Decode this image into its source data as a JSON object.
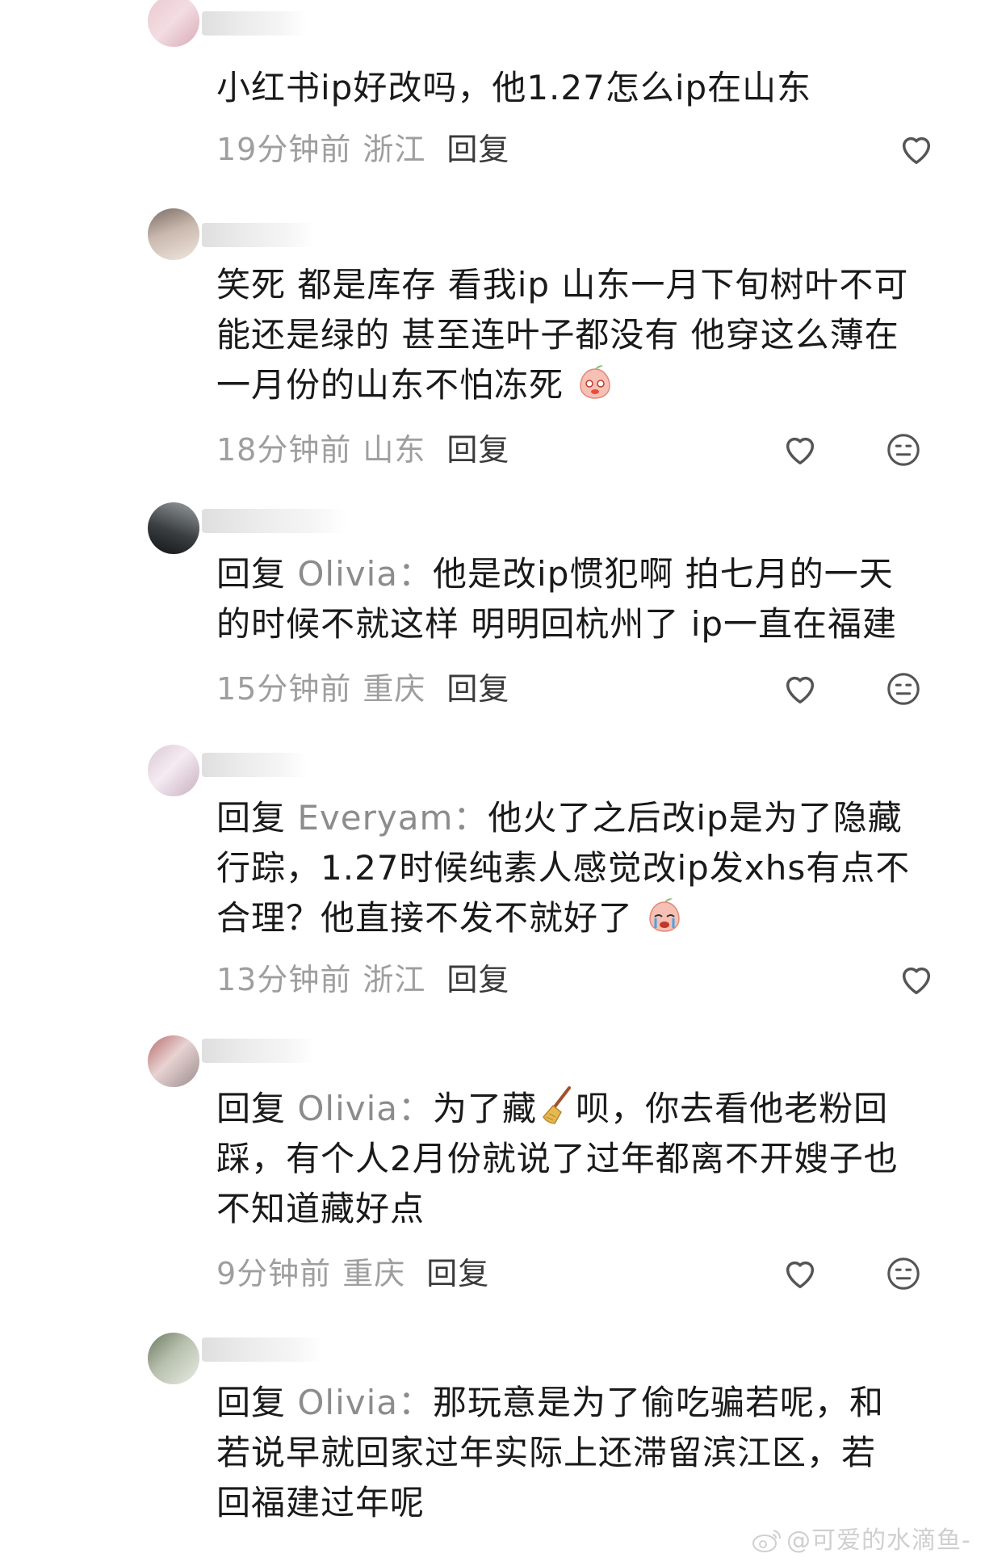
{
  "comments": [
    {
      "text_lines": [
        "小红书ip好改吗，他1.27怎么ip在山东"
      ],
      "time": "19分钟前",
      "location": "浙江",
      "reply_label": "回复",
      "icons": [
        "heart-outline-icon"
      ]
    },
    {
      "text_lines": [
        "笑死 都是库存 看我ip 山东一月下旬树叶不可",
        "能还是绿的 甚至连叶子都没有 他穿这么薄在",
        "一月份的山东不怕冻死"
      ],
      "emoji": "peach-shy-emoji",
      "time": "18分钟前",
      "location": "山东",
      "reply_label": "回复",
      "icons": [
        "heart-outline-icon",
        "emoji-face-icon"
      ]
    },
    {
      "reply_prefix": "回复",
      "reply_target": "Olivia：",
      "text_lines": [
        "他是改ip惯犯啊 拍七月的一天",
        "的时候不就这样 明明回杭州了 ip一直在福建"
      ],
      "time": "15分钟前",
      "location": "重庆",
      "reply_label": "回复",
      "icons": [
        "heart-outline-icon",
        "emoji-face-icon"
      ]
    },
    {
      "reply_prefix": "回复",
      "reply_target": "Everyam：",
      "text_lines": [
        "他火了之后改ip是为了隐藏",
        "行踪，1.27时候纯素人感觉改ip发xhs有点不",
        "合理？他直接不发不就好了"
      ],
      "emoji": "peach-crying-emoji",
      "time": "13分钟前",
      "location": "浙江",
      "reply_label": "回复",
      "icons": [
        "heart-outline-icon"
      ]
    },
    {
      "reply_prefix": "回复",
      "reply_target": "Olivia：",
      "text_lines": [
        "为了藏",
        "呗，你去看他老粉回",
        "踩，有个人2月份就说了过年都离不开嫂子也",
        "不知道藏好点"
      ],
      "emoji": "broom-emoji",
      "time": "9分钟前",
      "location": "重庆",
      "reply_label": "回复",
      "icons": [
        "heart-outline-icon",
        "emoji-face-icon"
      ]
    },
    {
      "reply_prefix": "回复",
      "reply_target": "Olivia：",
      "text_lines": [
        "那玩意是为了偷吃骗若呢，和",
        "若说早就回家过年实际上还滞留滨江区，若",
        "回福建过年呢"
      ],
      "icons": []
    }
  ],
  "watermark": "@可爱的水滴鱼-",
  "colors": {
    "text": "#1a1a1a",
    "meta": "#9e9e9e",
    "reply_target": "#8c8c8c",
    "icon": "#555555"
  }
}
